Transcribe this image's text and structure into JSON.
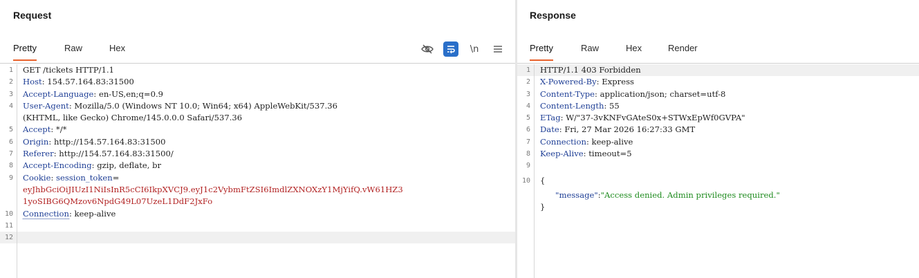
{
  "request": {
    "title": "Request",
    "tabs": [
      {
        "label": "Pretty",
        "active": true
      },
      {
        "label": "Raw",
        "active": false
      },
      {
        "label": "Hex",
        "active": false
      }
    ],
    "toolbar": {
      "hide_icon": "eye-slash-icon",
      "wrap_icon": "wrap-lines-icon",
      "newline_label": "\\n",
      "menu_icon": "hamburger-menu-icon"
    },
    "lines": [
      {
        "num": "1",
        "parts": [
          {
            "text": "GET /tickets HTTP/1.1",
            "style": "plain"
          }
        ]
      },
      {
        "num": "2",
        "parts": [
          {
            "text": "Host",
            "style": "hname"
          },
          {
            "text": ": 154.57.164.83:31500",
            "style": "plain"
          }
        ]
      },
      {
        "num": "3",
        "parts": [
          {
            "text": "Accept-Language",
            "style": "hname"
          },
          {
            "text": ": en-US,en;q=0.9",
            "style": "plain"
          }
        ]
      },
      {
        "num": "4",
        "parts": [
          {
            "text": "User-Agent",
            "style": "hname"
          },
          {
            "text": ": Mozilla/5.0 (Windows NT 10.0; Win64; x64) AppleWebKit/537.36",
            "style": "plain"
          }
        ]
      },
      {
        "num": "",
        "parts": [
          {
            "text": "(KHTML, like Gecko) Chrome/145.0.0.0 Safari/537.36",
            "style": "plain"
          }
        ]
      },
      {
        "num": "5",
        "parts": [
          {
            "text": "Accept",
            "style": "hname"
          },
          {
            "text": ": */*",
            "style": "plain"
          }
        ]
      },
      {
        "num": "6",
        "parts": [
          {
            "text": "Origin",
            "style": "hname"
          },
          {
            "text": ": http://154.57.164.83:31500",
            "style": "plain"
          }
        ]
      },
      {
        "num": "7",
        "parts": [
          {
            "text": "Referer",
            "style": "hname"
          },
          {
            "text": ": http://154.57.164.83:31500/",
            "style": "plain"
          }
        ]
      },
      {
        "num": "8",
        "parts": [
          {
            "text": "Accept-Encoding",
            "style": "hname"
          },
          {
            "text": ": gzip, deflate, br",
            "style": "plain"
          }
        ]
      },
      {
        "num": "9",
        "parts": [
          {
            "text": "Cookie",
            "style": "hname"
          },
          {
            "text": ": ",
            "style": "plain"
          },
          {
            "text": "session_token",
            "style": "hname"
          },
          {
            "text": "=",
            "style": "plain"
          }
        ]
      },
      {
        "num": "",
        "parts": [
          {
            "text": "eyJhbGciOiJIUzI1NiIsInR5cCI6IkpXVCJ9.eyJ1c2VybmFtZSI6ImdlZXNOXzY1MjYifQ.vW61HZ3",
            "style": "cval"
          }
        ]
      },
      {
        "num": "",
        "parts": [
          {
            "text": "1yoSIBG6QMzov6NpdG49L07UzeL1DdF2JxFo",
            "style": "cval"
          }
        ]
      },
      {
        "num": "10",
        "parts": [
          {
            "text": "Connection",
            "style": "conn-name"
          },
          {
            "text": ": keep-alive",
            "style": "plain"
          }
        ]
      },
      {
        "num": "11",
        "parts": []
      },
      {
        "num": "12",
        "parts": [],
        "highlight": true
      }
    ]
  },
  "response": {
    "title": "Response",
    "tabs": [
      {
        "label": "Pretty",
        "active": true
      },
      {
        "label": "Raw",
        "active": false
      },
      {
        "label": "Hex",
        "active": false
      },
      {
        "label": "Render",
        "active": false
      }
    ],
    "lines": [
      {
        "num": "1",
        "parts": [
          {
            "text": "HTTP/1.1 403 Forbidden",
            "style": "plain"
          }
        ],
        "highlight": true
      },
      {
        "num": "2",
        "parts": [
          {
            "text": "X-Powered-By",
            "style": "hname"
          },
          {
            "text": ": Express",
            "style": "plain"
          }
        ]
      },
      {
        "num": "3",
        "parts": [
          {
            "text": "Content-Type",
            "style": "hname"
          },
          {
            "text": ": application/json; charset=utf-8",
            "style": "plain"
          }
        ]
      },
      {
        "num": "4",
        "parts": [
          {
            "text": "Content-Length",
            "style": "hname"
          },
          {
            "text": ": 55",
            "style": "plain"
          }
        ]
      },
      {
        "num": "5",
        "parts": [
          {
            "text": "ETag",
            "style": "hname"
          },
          {
            "text": ": W/\"37-3vKNFvGAteS0x+STWxEpWf0GVPA\"",
            "style": "plain"
          }
        ]
      },
      {
        "num": "6",
        "parts": [
          {
            "text": "Date",
            "style": "hname"
          },
          {
            "text": ": Fri, 27 Mar 2026 16:27:33 GMT",
            "style": "plain"
          }
        ]
      },
      {
        "num": "7",
        "parts": [
          {
            "text": "Connection",
            "style": "hname"
          },
          {
            "text": ": keep-alive",
            "style": "plain"
          }
        ]
      },
      {
        "num": "8",
        "parts": [
          {
            "text": "Keep-Alive",
            "style": "hname"
          },
          {
            "text": ": timeout=5",
            "style": "plain"
          }
        ]
      },
      {
        "num": "9",
        "parts": []
      },
      {
        "num": "10",
        "parts": [
          {
            "text": "{",
            "style": "plain"
          }
        ],
        "gap_before": true
      },
      {
        "num": "",
        "parts": [
          {
            "text": "      ",
            "style": "plain"
          },
          {
            "text": "\"message\"",
            "style": "jkey"
          },
          {
            "text": ":",
            "style": "plain"
          },
          {
            "text": "\"Access denied. Admin privileges required.\"",
            "style": "jstr"
          }
        ],
        "gap_before": true
      },
      {
        "num": "",
        "parts": [
          {
            "text": "}",
            "style": "plain"
          }
        ]
      }
    ]
  },
  "colors": {
    "active_tab_underline": "#e8622c",
    "header_name": "#1f3f96",
    "cookie_value": "#b22222",
    "json_string": "#1e8b1e",
    "wrap_button_bg": "#2a6fc9"
  }
}
